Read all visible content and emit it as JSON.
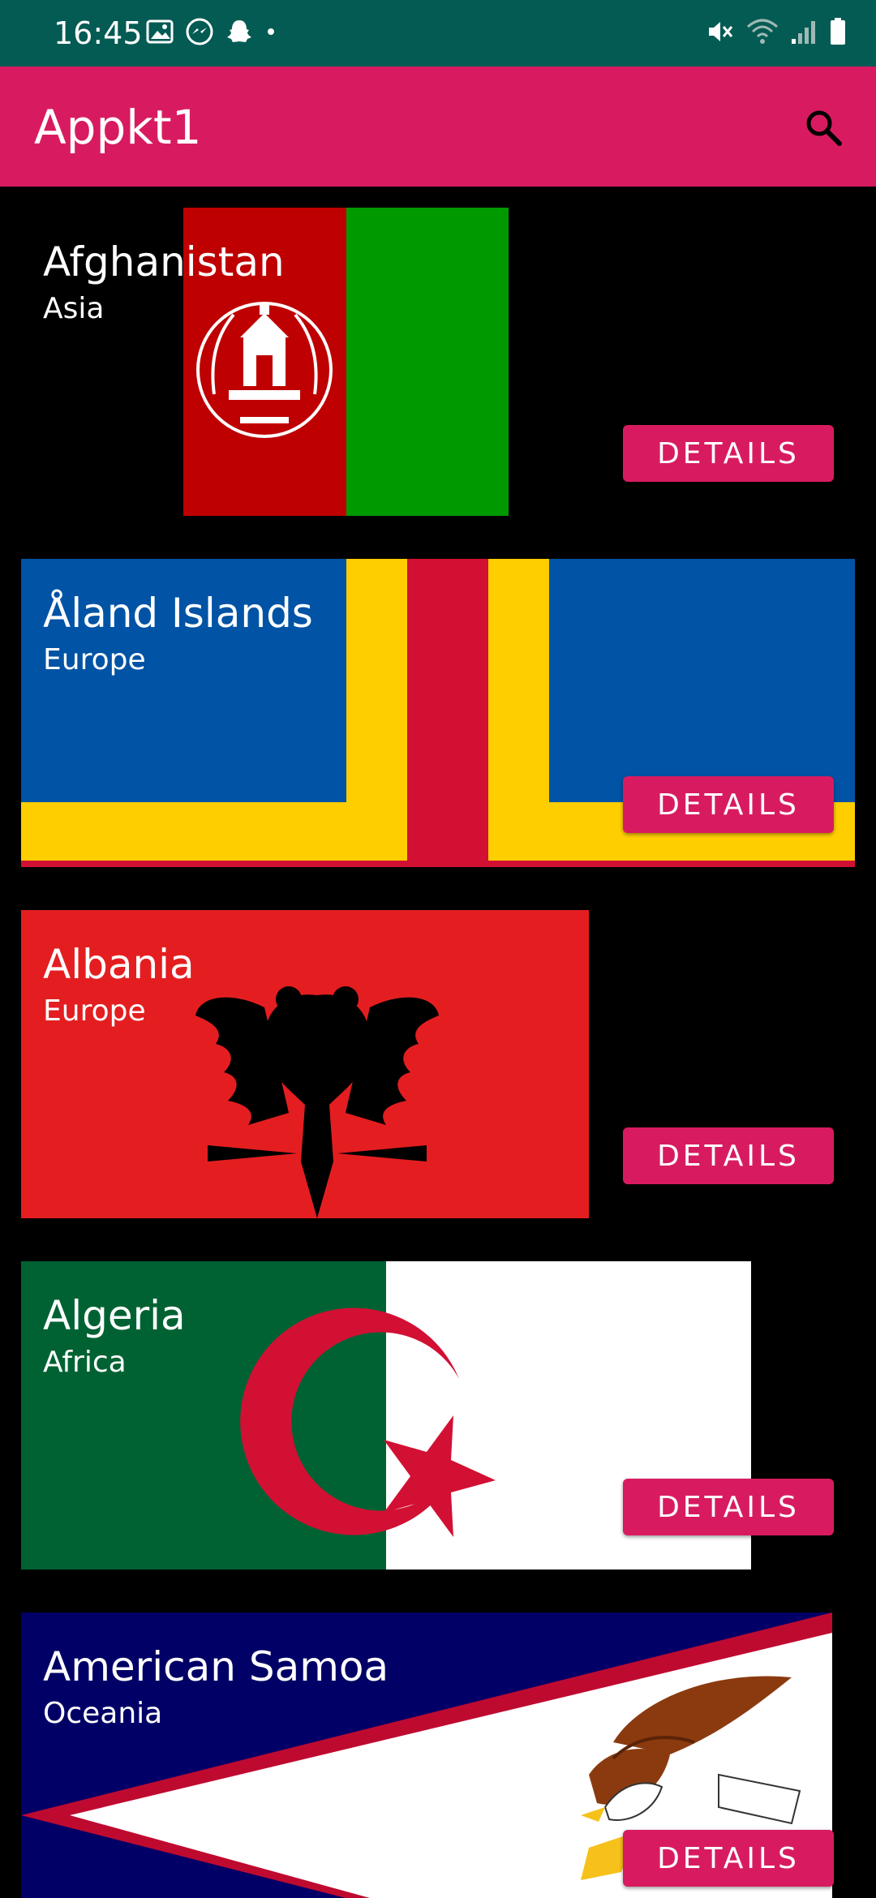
{
  "status_bar": {
    "time": "16:45",
    "left_icons": [
      "gallery-icon",
      "messenger-icon",
      "snapchat-icon",
      "dot-icon"
    ],
    "right_icons": [
      "mute-icon",
      "wifi-icon",
      "signal-icon",
      "battery-icon"
    ]
  },
  "app_bar": {
    "title": "Appkt1",
    "search_icon": "search-icon",
    "color": "#d81b60"
  },
  "countries": [
    {
      "name": "Afghanistan",
      "region": "Asia",
      "button": "DETAILS"
    },
    {
      "name": "Åland Islands",
      "region": "Europe",
      "button": "DETAILS"
    },
    {
      "name": "Albania",
      "region": "Europe",
      "button": "DETAILS"
    },
    {
      "name": "Algeria",
      "region": "Africa",
      "button": "DETAILS"
    },
    {
      "name": "American Samoa",
      "region": "Oceania",
      "button": "DETAILS"
    }
  ],
  "colors": {
    "status_bar": "#045b53",
    "accent": "#d81b60",
    "background": "#000000"
  }
}
